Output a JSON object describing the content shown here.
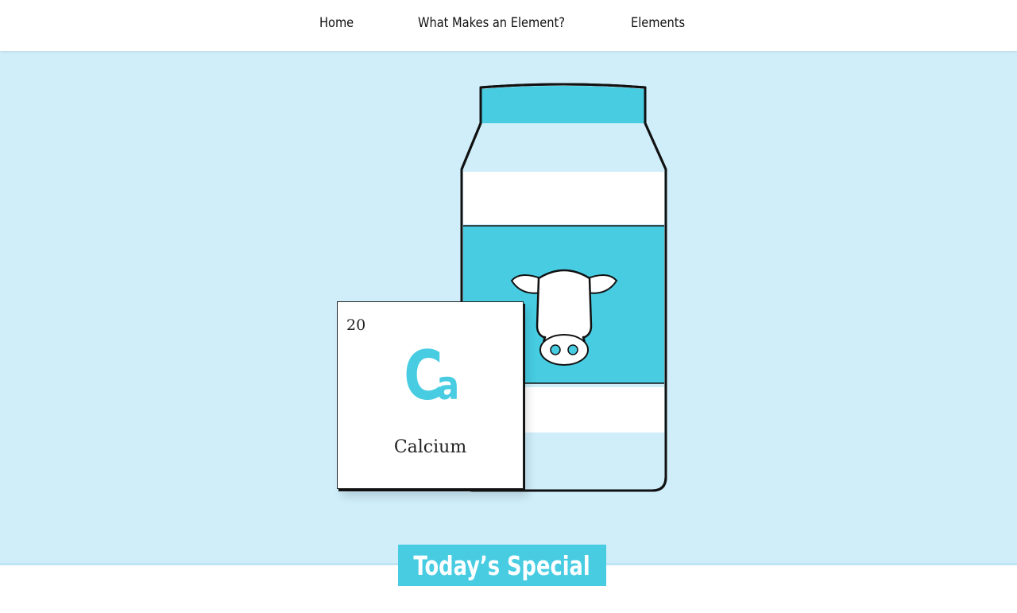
{
  "nav": {
    "home": "Home",
    "what": "What Makes an Element?",
    "elements": "Elements"
  },
  "hero": {
    "background_color": "#cfeefa",
    "illustration": "milk-carton-with-cow-icon"
  },
  "element": {
    "atomic_number": "20",
    "symbol_first": "C",
    "symbol_second": "a",
    "name": "Calcium",
    "accent_color": "#47cce2"
  },
  "special": {
    "label": "Today’s Special"
  }
}
